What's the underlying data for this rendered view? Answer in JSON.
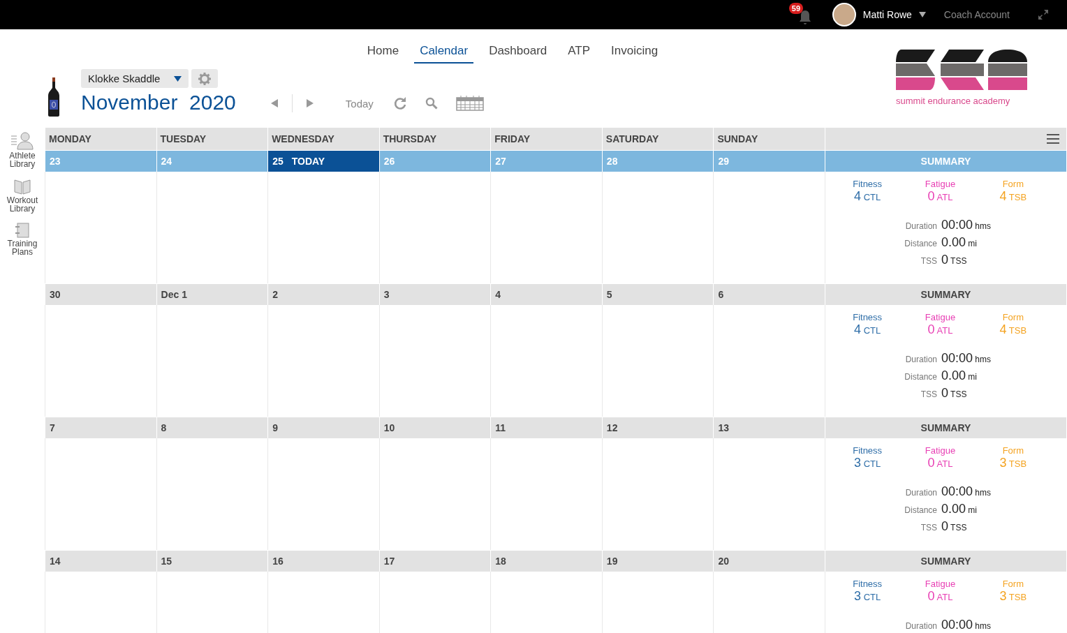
{
  "topbar": {
    "notifications": "59",
    "user": "Matti Rowe",
    "account": "Coach Account"
  },
  "nav": [
    {
      "label": "Home",
      "selected": false
    },
    {
      "label": "Calendar",
      "selected": true
    },
    {
      "label": "Dashboard",
      "selected": false
    },
    {
      "label": "ATP",
      "selected": false
    },
    {
      "label": "Invoicing",
      "selected": false
    }
  ],
  "athlete": "Klokke Skaddle",
  "title": {
    "month": "November",
    "year": "2020"
  },
  "toolbar": {
    "today": "Today"
  },
  "logo": {
    "tagline": "summit endurance academy"
  },
  "sidebar": [
    {
      "kind": "athlete",
      "label": "Athlete Library"
    },
    {
      "kind": "workout",
      "label": "Workout Library"
    },
    {
      "kind": "plans",
      "label": "Training Plans"
    }
  ],
  "weekdays": [
    "MONDAY",
    "TUESDAY",
    "WEDNESDAY",
    "THURSDAY",
    "FRIDAY",
    "SATURDAY",
    "SUNDAY"
  ],
  "weeks": [
    {
      "current": true,
      "days": [
        {
          "label": "23",
          "today": false
        },
        {
          "label": "24",
          "today": false
        },
        {
          "label": "25",
          "today": true,
          "badge": "TODAY"
        },
        {
          "label": "26",
          "today": false
        },
        {
          "label": "27",
          "today": false
        },
        {
          "label": "28",
          "today": false
        },
        {
          "label": "29",
          "today": false
        }
      ],
      "summary": {
        "label": "SUMMARY",
        "metrics": [
          {
            "label": "Fitness",
            "value": "4",
            "unit": "CTL",
            "color": "#2f6ea8"
          },
          {
            "label": "Fatigue",
            "value": "0",
            "unit": "ATL",
            "color": "#e83fb4"
          },
          {
            "label": "Form",
            "value": "4",
            "unit": "TSB",
            "color": "#f4a321"
          }
        ],
        "stats": [
          {
            "label": "Duration",
            "value": "00:00",
            "unit": "hms"
          },
          {
            "label": "Distance",
            "value": "0.00",
            "unit": "mi"
          },
          {
            "label": "TSS",
            "value": "0",
            "unit": "TSS"
          }
        ]
      }
    },
    {
      "current": false,
      "days": [
        {
          "label": "30",
          "today": false
        },
        {
          "label": "Dec 1",
          "today": false
        },
        {
          "label": "2",
          "today": false
        },
        {
          "label": "3",
          "today": false
        },
        {
          "label": "4",
          "today": false
        },
        {
          "label": "5",
          "today": false
        },
        {
          "label": "6",
          "today": false
        }
      ],
      "summary": {
        "label": "SUMMARY",
        "metrics": [
          {
            "label": "Fitness",
            "value": "4",
            "unit": "CTL",
            "color": "#2f6ea8"
          },
          {
            "label": "Fatigue",
            "value": "0",
            "unit": "ATL",
            "color": "#e83fb4"
          },
          {
            "label": "Form",
            "value": "4",
            "unit": "TSB",
            "color": "#f4a321"
          }
        ],
        "stats": [
          {
            "label": "Duration",
            "value": "00:00",
            "unit": "hms"
          },
          {
            "label": "Distance",
            "value": "0.00",
            "unit": "mi"
          },
          {
            "label": "TSS",
            "value": "0",
            "unit": "TSS"
          }
        ]
      }
    },
    {
      "current": false,
      "days": [
        {
          "label": "7",
          "today": false
        },
        {
          "label": "8",
          "today": false
        },
        {
          "label": "9",
          "today": false
        },
        {
          "label": "10",
          "today": false
        },
        {
          "label": "11",
          "today": false
        },
        {
          "label": "12",
          "today": false
        },
        {
          "label": "13",
          "today": false
        }
      ],
      "summary": {
        "label": "SUMMARY",
        "metrics": [
          {
            "label": "Fitness",
            "value": "3",
            "unit": "CTL",
            "color": "#2f6ea8"
          },
          {
            "label": "Fatigue",
            "value": "0",
            "unit": "ATL",
            "color": "#e83fb4"
          },
          {
            "label": "Form",
            "value": "3",
            "unit": "TSB",
            "color": "#f4a321"
          }
        ],
        "stats": [
          {
            "label": "Duration",
            "value": "00:00",
            "unit": "hms"
          },
          {
            "label": "Distance",
            "value": "0.00",
            "unit": "mi"
          },
          {
            "label": "TSS",
            "value": "0",
            "unit": "TSS"
          }
        ]
      }
    },
    {
      "current": false,
      "days": [
        {
          "label": "14",
          "today": false
        },
        {
          "label": "15",
          "today": false
        },
        {
          "label": "16",
          "today": false
        },
        {
          "label": "17",
          "today": false
        },
        {
          "label": "18",
          "today": false
        },
        {
          "label": "19",
          "today": false
        },
        {
          "label": "20",
          "today": false
        }
      ],
      "summary": {
        "label": "SUMMARY",
        "metrics": [
          {
            "label": "Fitness",
            "value": "3",
            "unit": "CTL",
            "color": "#2f6ea8"
          },
          {
            "label": "Fatigue",
            "value": "0",
            "unit": "ATL",
            "color": "#e83fb4"
          },
          {
            "label": "Form",
            "value": "3",
            "unit": "TSB",
            "color": "#f4a321"
          }
        ],
        "stats": [
          {
            "label": "Duration",
            "value": "00:00",
            "unit": "hms"
          }
        ]
      }
    }
  ]
}
